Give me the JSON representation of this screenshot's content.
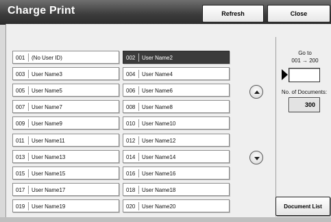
{
  "header": {
    "title": "Charge Print",
    "refresh_label": "Refresh",
    "close_label": "Close"
  },
  "users": [
    {
      "num": "001",
      "name": "(No User ID)",
      "selected": false
    },
    {
      "num": "002",
      "name": "User Name2",
      "selected": true
    },
    {
      "num": "003",
      "name": "User Name3",
      "selected": false
    },
    {
      "num": "004",
      "name": "User Name4",
      "selected": false
    },
    {
      "num": "005",
      "name": "User Name5",
      "selected": false
    },
    {
      "num": "006",
      "name": "User Name6",
      "selected": false
    },
    {
      "num": "007",
      "name": "User Name7",
      "selected": false
    },
    {
      "num": "008",
      "name": "User Name8",
      "selected": false
    },
    {
      "num": "009",
      "name": "User Name9",
      "selected": false
    },
    {
      "num": "010",
      "name": "User Name10",
      "selected": false
    },
    {
      "num": "011",
      "name": "User Name11",
      "selected": false
    },
    {
      "num": "012",
      "name": "User Name12",
      "selected": false
    },
    {
      "num": "013",
      "name": "User Name13",
      "selected": false
    },
    {
      "num": "014",
      "name": "User Name14",
      "selected": false
    },
    {
      "num": "015",
      "name": "User Name15",
      "selected": false
    },
    {
      "num": "016",
      "name": "User Name16",
      "selected": false
    },
    {
      "num": "017",
      "name": "User Name17",
      "selected": false
    },
    {
      "num": "018",
      "name": "User Name18",
      "selected": false
    },
    {
      "num": "019",
      "name": "User Name19",
      "selected": false
    },
    {
      "num": "020",
      "name": "User Name20",
      "selected": false
    }
  ],
  "scroll": {
    "up_icon": "chevron-up-icon",
    "down_icon": "chevron-down-icon"
  },
  "goto": {
    "label": "Go to",
    "range": "001 → 200",
    "value": "",
    "pointer_icon": "pointer-triangle-icon"
  },
  "documents": {
    "label": "No. of Documents:",
    "count": "300"
  },
  "document_list_label": "Document List",
  "colors": {
    "title_bar": "#3c3c3c",
    "selected_row": "#3b3b3b",
    "panel": "#efefef"
  }
}
